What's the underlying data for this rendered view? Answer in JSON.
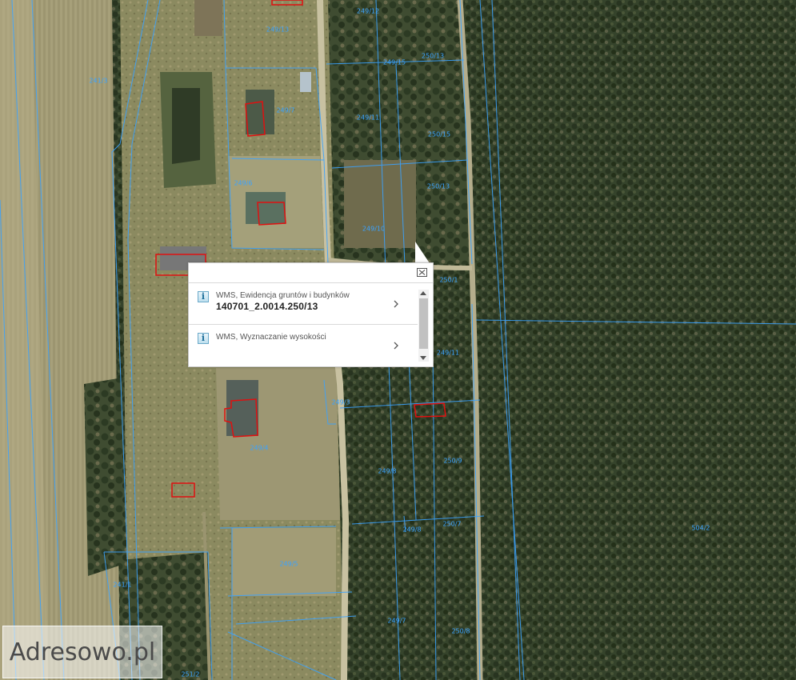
{
  "map": {
    "parcel_labels": [
      {
        "id": "p1",
        "text": "249/12"
      },
      {
        "id": "p2",
        "text": "249/13"
      },
      {
        "id": "p3",
        "text": "249/15"
      },
      {
        "id": "p4",
        "text": "250/13"
      },
      {
        "id": "p5",
        "text": "241/3"
      },
      {
        "id": "p6",
        "text": "249/7"
      },
      {
        "id": "p7",
        "text": "249/11"
      },
      {
        "id": "p8",
        "text": "250/15"
      },
      {
        "id": "p9",
        "text": "249/6"
      },
      {
        "id": "p10",
        "text": "250/13"
      },
      {
        "id": "p11",
        "text": "249/10"
      },
      {
        "id": "p12",
        "text": "250/1"
      },
      {
        "id": "p13",
        "text": "249/11"
      },
      {
        "id": "p14",
        "text": "249/3"
      },
      {
        "id": "p15",
        "text": "249/4"
      },
      {
        "id": "p16",
        "text": "249/8"
      },
      {
        "id": "p17",
        "text": "250/9"
      },
      {
        "id": "p18",
        "text": "249/8"
      },
      {
        "id": "p19",
        "text": "250/7"
      },
      {
        "id": "p20",
        "text": "504/2"
      },
      {
        "id": "p21",
        "text": "249/5"
      },
      {
        "id": "p22",
        "text": "241/1"
      },
      {
        "id": "p23",
        "text": "249/7"
      },
      {
        "id": "p24",
        "text": "250/8"
      },
      {
        "id": "p25",
        "text": "251/2"
      }
    ]
  },
  "popup": {
    "items": [
      {
        "title": "WMS, Ewidencja gruntów i budynków",
        "value": "140701_2.0014.250/13"
      },
      {
        "title": "WMS, Wyznaczanie wysokości",
        "value": ""
      }
    ]
  },
  "watermark": {
    "text": "Adresowo.pl"
  },
  "colors": {
    "parcel_line": "#3aa2ff",
    "building_outline": "#e01010",
    "forest": "#2f3d27",
    "meadow": "#8c8a5c"
  },
  "icons": {
    "info": "info-icon",
    "close": "close-icon",
    "chevron": "chevron-right-icon",
    "scroll_up": "scroll-up-icon",
    "scroll_down": "scroll-down-icon"
  }
}
